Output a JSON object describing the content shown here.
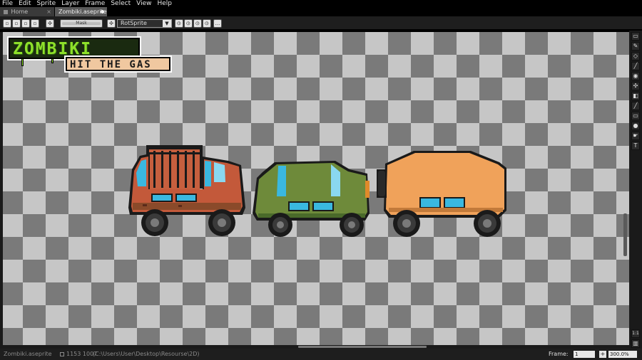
{
  "menu": [
    "File",
    "Edit",
    "Sprite",
    "Layer",
    "Frame",
    "Select",
    "View",
    "Help"
  ],
  "tabs": {
    "home": {
      "label": "Home",
      "close": "×"
    },
    "file": {
      "label": "Zombiki.aseprite"
    }
  },
  "toolbar": {
    "mask_label": "Mask",
    "rotation_algorithm": "RotSprite",
    "more_label": "..."
  },
  "logo": {
    "title": "ZOMBIKI",
    "subtitle": "HIT THE GAS"
  },
  "status": {
    "filename": "Zombiki.aseprite",
    "sprite_size": "1153 1007",
    "path": "(C:\\Users\\User\\Desktop\\Resourse\\2D)",
    "frame_label": "Frame:",
    "frame_value": "1",
    "plus": "+",
    "zoom": "300.0%"
  },
  "tools": [
    "marquee-icon",
    "pencil-icon",
    "eraser-icon",
    "eyedropper-icon",
    "zoom-icon",
    "move-icon",
    "fill-icon",
    "line-icon",
    "rectangle-icon",
    "blur-icon",
    "smudge-icon",
    "text-icon"
  ],
  "tools_bottom": [
    "1:1",
    "preview"
  ],
  "colors": {
    "checker_light": "#c6c6c6",
    "checker_dark": "#7a7a7a",
    "car1_body": "#c3593a",
    "car2_body": "#6e8a3a",
    "car3_body": "#f0a25a",
    "window": "#3ab8e0"
  }
}
